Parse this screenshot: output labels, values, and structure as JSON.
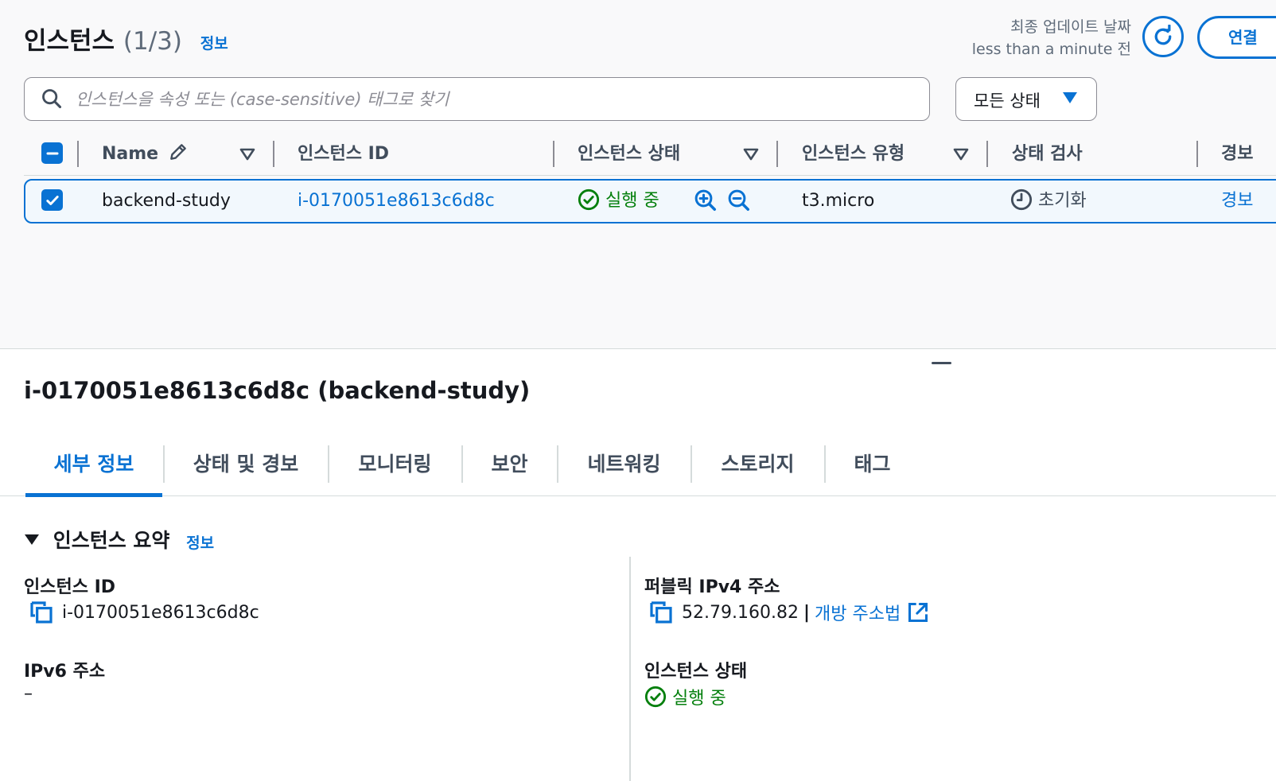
{
  "header": {
    "title": "인스턴스",
    "count": "(1/3)",
    "info": "정보",
    "last_updated_label": "최종 업데이트 날짜",
    "last_updated_value": "less than a minute 전",
    "connect_label": "연결"
  },
  "search": {
    "placeholder": "인스턴스을 속성 또는 (case-sensitive) 태그로 찾기",
    "value": ""
  },
  "state_filter": {
    "selected": "모든 상태"
  },
  "table": {
    "columns": [
      "Name",
      "인스턴스 ID",
      "인스턴스 상태",
      "인스턴스 유형",
      "상태 검사",
      "경보"
    ],
    "rows": [
      {
        "name": "backend-study",
        "instance_id": "i-0170051e8613c6d8c",
        "state": "실행 중",
        "type": "t3.micro",
        "status_check": "초기화",
        "alarm": "경보"
      }
    ]
  },
  "detail": {
    "title": "i-0170051e8613c6d8c (backend-study)",
    "tabs": [
      "세부 정보",
      "상태 및 경보",
      "모니터링",
      "보안",
      "네트워킹",
      "스토리지",
      "태그"
    ],
    "section_title": "인스턴스 요약",
    "section_info": "정보",
    "instance_id_label": "인스턴스 ID",
    "instance_id_value": "i-0170051e8613c6d8c",
    "ipv6_label": "IPv6 주소",
    "ipv6_value": "–",
    "public_ipv4_label": "퍼블릭 IPv4 주소",
    "public_ipv4_value": "52.79.160.82",
    "public_ipv4_sep": "|",
    "open_address_label": "개방 주소법",
    "state_label": "인스턴스 상태",
    "state_value": "실행 중"
  },
  "colors": {
    "accent": "#0972d3",
    "success": "#037f0c",
    "text": "#16191f",
    "muted": "#5f6b7a"
  },
  "icons": [
    "search-icon",
    "refresh-icon",
    "caret-down-icon",
    "edit-pencil-icon",
    "sort-caret-icon",
    "checkbox-checked-icon",
    "checkbox-indeterminate-icon",
    "success-check-icon",
    "zoom-in-icon",
    "zoom-out-icon",
    "pending-clock-icon",
    "copy-icon",
    "external-link-icon",
    "collapse-triangle-icon"
  ]
}
